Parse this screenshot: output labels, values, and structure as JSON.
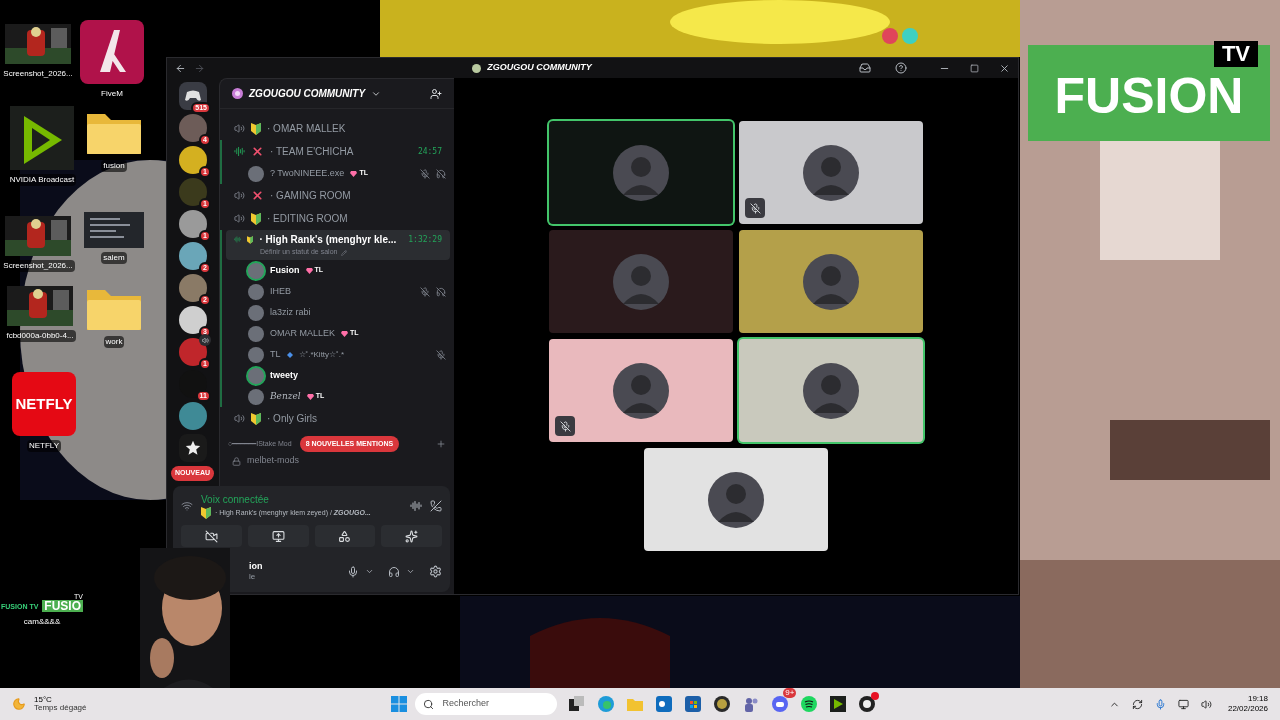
{
  "desktop_icons": [
    {
      "label": "Screenshot_2026...",
      "kind": "thumb"
    },
    {
      "label": "FiveM",
      "kind": "fivem"
    },
    {
      "label": "NVIDIA Broadcast",
      "kind": "nvidia"
    },
    {
      "label": "fusion",
      "kind": "folder"
    },
    {
      "label": "Screenshot_2026...",
      "kind": "thumb"
    },
    {
      "label": "salem",
      "kind": "doc"
    },
    {
      "label": "fcbd000a-0bb0-4...",
      "kind": "thumb"
    },
    {
      "label": "work",
      "kind": "folder"
    },
    {
      "label": "NETFLY",
      "kind": "netfly",
      "logo": "NETFLY"
    },
    {
      "label": "cam&&&&",
      "kind": "cam",
      "logo": "FUSION TV",
      "logo2": "FUSIO",
      "logo2_top": "TV"
    }
  ],
  "overlay_logo": {
    "top": "TV",
    "main": "FUSION"
  },
  "window": {
    "title": "ZGOUGOU COMMUNITY"
  },
  "servers": [
    {
      "kind": "home",
      "badge": "515",
      "color": "#3a3c44",
      "in_voice": false
    },
    {
      "kind": "avatar",
      "badge": "4",
      "color": "#6d5c58",
      "in_voice": false
    },
    {
      "kind": "avatar",
      "badge": "1",
      "color": "#d4b020",
      "in_voice": false
    },
    {
      "kind": "avatar",
      "badge": "1",
      "color": "#3b3a1c",
      "in_voice": false
    },
    {
      "kind": "avatar",
      "badge": "1",
      "color": "#9a9a9a",
      "in_voice": false
    },
    {
      "kind": "avatar",
      "badge": "2",
      "color": "#6aa6b8",
      "in_voice": false
    },
    {
      "kind": "avatar",
      "badge": "2",
      "color": "#8a7a66",
      "in_voice": false
    },
    {
      "kind": "avatar",
      "badge": "3",
      "color": "#cfcfcf",
      "in_voice": false
    },
    {
      "kind": "avatar",
      "badge": "1",
      "color": "#c0262b",
      "in_voice": true
    },
    {
      "kind": "avatar",
      "badge": "11",
      "color": "#111111",
      "in_voice": false
    },
    {
      "kind": "avatar",
      "color": "#3f8a96",
      "in_voice": false
    },
    {
      "kind": "star",
      "color": "#1a1a1a",
      "in_voice": false
    }
  ],
  "new_pill": "NOUVEAU",
  "server": {
    "name": "ZGOUGOU COMMUNITY"
  },
  "channels": [
    {
      "name": "· OMAR MALLEK",
      "kind": "shield",
      "active": false,
      "selected": false
    },
    {
      "name": "· TEAM E'CHICHA",
      "kind": "cross",
      "active": true,
      "selected": false,
      "timer": "24:57",
      "members": [
        {
          "name": "? TwoNINEEE.exe",
          "kind": "plain",
          "tag": "TL",
          "speaking": false,
          "muted": true,
          "deafened": true
        }
      ]
    },
    {
      "name": "· GAMING ROOM",
      "kind": "cross",
      "active": false,
      "selected": false
    },
    {
      "name": "· EDITING ROOM",
      "kind": "shield",
      "active": false,
      "selected": false
    },
    {
      "name": "· High Rank's (menghyr kle...",
      "kind": "shield",
      "active": true,
      "selected": true,
      "timer": "1:32:29",
      "status": "Définir un statut de salon",
      "members": [
        {
          "name": "Fusion",
          "kind": "bold",
          "tag": "TL",
          "speaking": true,
          "muted": false,
          "deafened": false
        },
        {
          "name": "IHEB",
          "kind": "plain",
          "speaking": false,
          "muted": true,
          "deafened": true
        },
        {
          "name": "la3ziz rabi",
          "kind": "plain",
          "speaking": false,
          "muted": false,
          "deafened": false
        },
        {
          "name": "OMAR MALLEK",
          "kind": "plain",
          "tag": "TL",
          "speaking": false,
          "muted": false,
          "deafened": false
        },
        {
          "name": "TL",
          "suffix": "☆˚.*Kitty☆˚.*",
          "kind": "plain",
          "speaking": false,
          "muted": true,
          "deafened": false
        },
        {
          "name": "tweety",
          "kind": "bold",
          "speaking": true,
          "muted": false,
          "deafened": false
        },
        {
          "name": "Benzel",
          "kind": "serif",
          "tag": "TL",
          "speaking": false,
          "muted": false,
          "deafened": false
        }
      ]
    },
    {
      "name": "· Only Girls",
      "kind": "shield",
      "active": false,
      "selected": false
    }
  ],
  "category": "○━━━━━━IStake Mod",
  "text_channel": "melbet-mods",
  "mentions_pill": "8 NOUVELLES MENTIONS",
  "voice_panel": {
    "status": "Voix connectée",
    "channel": "· High Rank's (menghyr klem zeyed) /",
    "server": "ZGOUGO...",
    "buttons": [
      {
        "kind": "camera_off"
      },
      {
        "kind": "screen"
      },
      {
        "kind": "activities"
      },
      {
        "kind": "soundboard"
      }
    ]
  },
  "user": {
    "name": "ion",
    "status": "le"
  },
  "tiles": [
    {
      "color": "#0f1512",
      "speaking": true,
      "muted": false
    },
    {
      "color": "#c9c9cc",
      "speaking": false,
      "muted": true
    },
    {
      "color": "#2a1a1c",
      "speaking": false,
      "muted": false
    },
    {
      "color": "#b4a04a",
      "speaking": false,
      "muted": false
    },
    {
      "color": "#e9b9bd",
      "speaking": false,
      "muted": true
    },
    {
      "color": "#c9c9bd",
      "speaking": true,
      "muted": false
    },
    {
      "color": "#e2e2e2",
      "speaking": false,
      "muted": false
    }
  ],
  "taskbar": {
    "temp": "15°C",
    "weather": "Temps dégagé",
    "search": "Rechercher",
    "discord_badge": "9+",
    "time": "19:18",
    "date": "22/02/2026"
  }
}
